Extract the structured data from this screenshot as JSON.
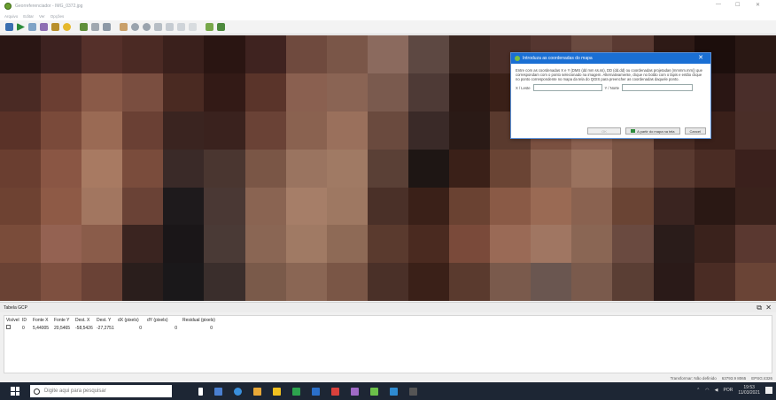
{
  "window": {
    "title": "Georreferenciador - IMG_0372.jpg",
    "minimize": "—",
    "maximize": "☐",
    "close": "✕"
  },
  "menu": [
    "Arquivo",
    "Editar",
    "Ver",
    "Opções"
  ],
  "gcp_panel": {
    "title": "Tabela GCP",
    "float_icon": "⧉",
    "close_icon": "✕",
    "columns": [
      "Visível",
      "ID",
      "Fonte X",
      "Fonte Y",
      "Dest. X",
      "Dest. Y",
      "dX (pixels)",
      "dY (pixels)",
      "Residual (pixels)"
    ],
    "rows": [
      {
        "visible": true,
        "id": "0",
        "src_x": "5,44005",
        "src_y": "20,5465",
        "dst_x": "-58,5426",
        "dst_y": "-27,2751",
        "dx": "0",
        "dy": "0",
        "residual": "0"
      }
    ]
  },
  "status": {
    "transform": "Transformar: Não definido",
    "coords": "63793.9 8065",
    "crs": "EPSG:4326"
  },
  "dialog": {
    "title": "Introduza as coordenadas do mapa",
    "description": "Entre com as coordenadas X e Y (DMS (dd mm ss.ss), DD (dd.dd) ou coordenadas projetadas (mmmm.mm)) que correspondam com o ponto selecionado na imagem. Alternativamente, clique no botão com o lápis e então clique no ponto correspondente no mapa da tela do QGIS para preencher as coordenadas daquele ponto.",
    "x_label": "X / Leste",
    "y_label": "Y / Norte",
    "x_value": "",
    "y_value": "",
    "ok_label": "OK",
    "from_canvas_label": "A partir do mapa na tela",
    "cancel_label": "Cancel"
  },
  "taskbar": {
    "search_placeholder": "Digite aqui para pesquisar",
    "lang": "POR",
    "time": "19:53",
    "date": "11/03/2021"
  },
  "colors": {
    "accent": "#1a6fd4",
    "taskbar": "#1d2634",
    "dialog_border": "#5a8fd6"
  }
}
